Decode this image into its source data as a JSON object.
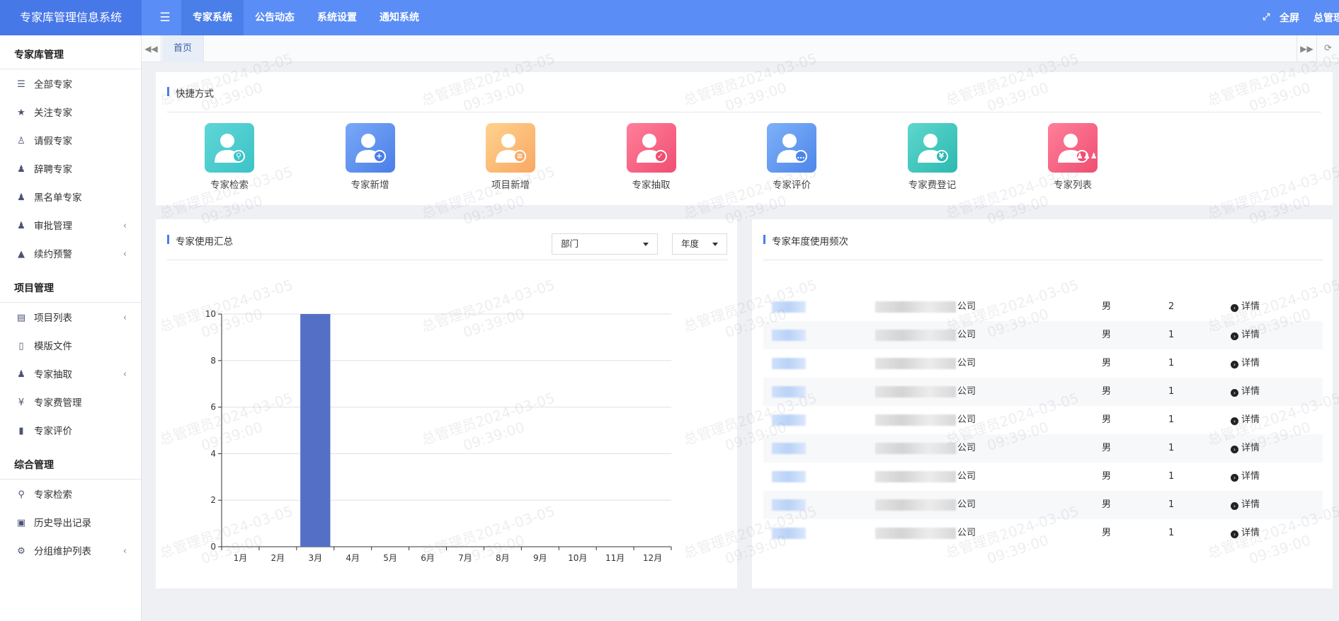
{
  "app": {
    "title": "专家库管理信息系统"
  },
  "topnav": {
    "items": [
      {
        "label": "专家系统",
        "active": true
      },
      {
        "label": "公告动态",
        "active": false
      },
      {
        "label": "系统设置",
        "active": false
      },
      {
        "label": "通知系统",
        "active": false
      }
    ],
    "fullscreen_label": "全屏",
    "user_label": "总管理"
  },
  "sidebar": {
    "sections": [
      {
        "title": "专家库管理",
        "items": [
          {
            "label": "全部专家",
            "icon": "list-icon",
            "glyph": "☰",
            "chevron": false
          },
          {
            "label": "关注专家",
            "icon": "star-icon",
            "glyph": "★",
            "chevron": false
          },
          {
            "label": "请假专家",
            "icon": "user-outline-icon",
            "glyph": "♙",
            "chevron": false
          },
          {
            "label": "辞聘专家",
            "icon": "user-remove-icon",
            "glyph": "♟",
            "chevron": false
          },
          {
            "label": "黑名单专家",
            "icon": "user-block-icon",
            "glyph": "♟",
            "chevron": false
          },
          {
            "label": "审批管理",
            "icon": "user-check-icon",
            "glyph": "♟",
            "chevron": true
          },
          {
            "label": "续约预警",
            "icon": "warning-icon",
            "glyph": "▲",
            "chevron": true
          }
        ]
      },
      {
        "title": "项目管理",
        "items": [
          {
            "label": "项目列表",
            "icon": "archive-icon",
            "glyph": "▤",
            "chevron": true
          },
          {
            "label": "模版文件",
            "icon": "file-icon",
            "glyph": "▯",
            "chevron": false
          },
          {
            "label": "专家抽取",
            "icon": "user-extract-icon",
            "glyph": "♟",
            "chevron": true
          },
          {
            "label": "专家费管理",
            "icon": "yen-icon",
            "glyph": "¥",
            "chevron": false
          },
          {
            "label": "专家评价",
            "icon": "bookmark-icon",
            "glyph": "▮",
            "chevron": false
          }
        ]
      },
      {
        "title": "综合管理",
        "items": [
          {
            "label": "专家检索",
            "icon": "search-icon",
            "glyph": "⚲",
            "chevron": false
          },
          {
            "label": "历史导出记录",
            "icon": "export-record-icon",
            "glyph": "▣",
            "chevron": false
          },
          {
            "label": "分组维护列表",
            "icon": "gear-icon",
            "glyph": "⚙",
            "chevron": true
          }
        ]
      }
    ]
  },
  "tabs": {
    "home_label": "首页"
  },
  "shortcuts": {
    "title": "快捷方式",
    "items": [
      {
        "label": "专家检索",
        "icon": "expert-search-icon",
        "color_from": "#5fd6d6",
        "color_to": "#3cc3c8",
        "glyph": "⚲"
      },
      {
        "label": "专家新增",
        "icon": "expert-add-icon",
        "color_from": "#7aa9f7",
        "color_to": "#4a7ee8",
        "glyph": "+"
      },
      {
        "label": "项目新增",
        "icon": "project-add-icon",
        "color_from": "#ffd28e",
        "color_to": "#f8a863",
        "glyph": "≡"
      },
      {
        "label": "专家抽取",
        "icon": "expert-extract-icon",
        "color_from": "#ff7f9a",
        "color_to": "#f04e72",
        "glyph": "✓"
      },
      {
        "label": "专家评价",
        "icon": "expert-review-icon",
        "color_from": "#7fb1f8",
        "color_to": "#4c86ea",
        "glyph": "…"
      },
      {
        "label": "专家费登记",
        "icon": "fee-register-icon",
        "color_from": "#5ed7cc",
        "color_to": "#2cb9b1",
        "glyph": "¥"
      },
      {
        "label": "专家列表",
        "icon": "expert-list-icon",
        "color_from": "#ff7f9a",
        "color_to": "#ef4e72",
        "glyph": "♟♟♟"
      }
    ]
  },
  "usage_summary": {
    "title": "专家使用汇总",
    "dept_select": "部门",
    "year_select": "年度"
  },
  "chart_data": {
    "type": "bar",
    "categories": [
      "1月",
      "2月",
      "3月",
      "4月",
      "5月",
      "6月",
      "7月",
      "8月",
      "9月",
      "10月",
      "11月",
      "12月"
    ],
    "values": [
      0,
      0,
      10,
      0,
      0,
      0,
      0,
      0,
      0,
      0,
      0,
      0
    ],
    "yticks": [
      "0",
      "2",
      "4",
      "6",
      "8",
      "10"
    ],
    "ylim": [
      0,
      10
    ],
    "grid": true,
    "color": "#5470c6"
  },
  "frequency": {
    "title": "专家年度使用频次",
    "detail_label": "详情",
    "rows": [
      {
        "company_suffix": "公司",
        "gender": "男",
        "count": "2"
      },
      {
        "company_suffix": "公司",
        "gender": "男",
        "count": "1"
      },
      {
        "company_suffix": "公司",
        "gender": "男",
        "count": "1"
      },
      {
        "company_suffix": "公司",
        "gender": "男",
        "count": "1"
      },
      {
        "company_suffix": "公司",
        "gender": "男",
        "count": "1"
      },
      {
        "company_suffix": "公司",
        "gender": "男",
        "count": "1"
      },
      {
        "company_suffix": "公司",
        "gender": "男",
        "count": "1"
      },
      {
        "company_suffix": "公司",
        "gender": "男",
        "count": "1"
      },
      {
        "company_suffix": "公司",
        "gender": "男",
        "count": "1"
      }
    ]
  },
  "watermark": {
    "line1": "总管理员2024-03-05",
    "line2": "09:39:00"
  }
}
